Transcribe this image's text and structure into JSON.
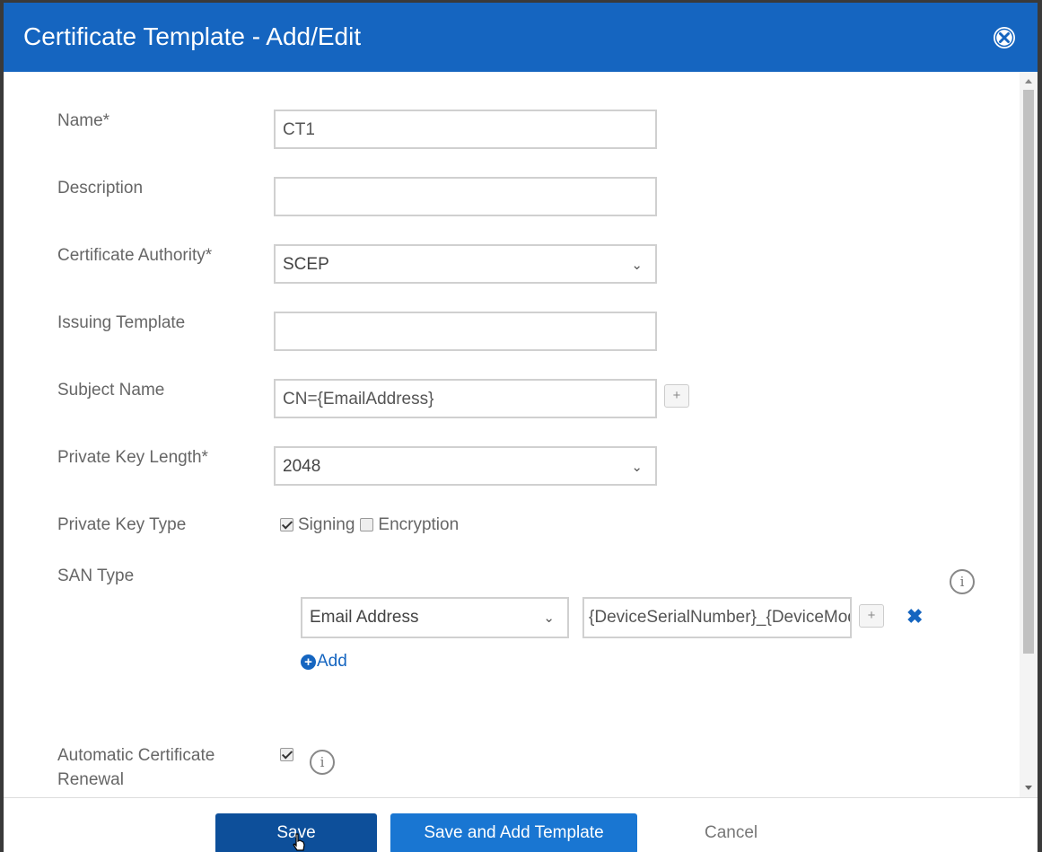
{
  "dialog": {
    "title": "Certificate Template - Add/Edit",
    "close_icon": "close-circle-icon"
  },
  "form": {
    "name": {
      "label": "Name*",
      "value": "CT1"
    },
    "description": {
      "label": "Description",
      "value": ""
    },
    "certificate_authority": {
      "label": "Certificate Authority*",
      "selected": "SCEP"
    },
    "issuing_template": {
      "label": "Issuing Template",
      "value": ""
    },
    "subject_name": {
      "label": "Subject Name",
      "value": "CN={EmailAddress}",
      "plus": "+"
    },
    "private_key_length": {
      "label": "Private Key Length*",
      "selected": "2048"
    },
    "private_key_type": {
      "label": "Private Key Type",
      "options": [
        {
          "label": "Signing",
          "checked": true
        },
        {
          "label": "Encryption",
          "checked": false
        }
      ]
    },
    "san_type": {
      "label": "SAN Type",
      "info_icon": "info-icon",
      "rows": [
        {
          "type": "Email Address",
          "value": "{DeviceSerialNumber}_{DeviceModel}",
          "plus": "+",
          "remove_icon": "remove-x-icon"
        }
      ],
      "add_label": "Add"
    },
    "auto_renewal": {
      "label": "Automatic Certificate Renewal",
      "checked": true,
      "info_icon": "info-icon"
    }
  },
  "footer": {
    "save_label": "Save",
    "save_add_label": "Save and Add Template",
    "cancel_label": "Cancel"
  },
  "colors": {
    "title_bar": "#1565c0",
    "save_button": "#0d4f9a",
    "save_add_button": "#1976d2",
    "link": "#1565c0"
  }
}
